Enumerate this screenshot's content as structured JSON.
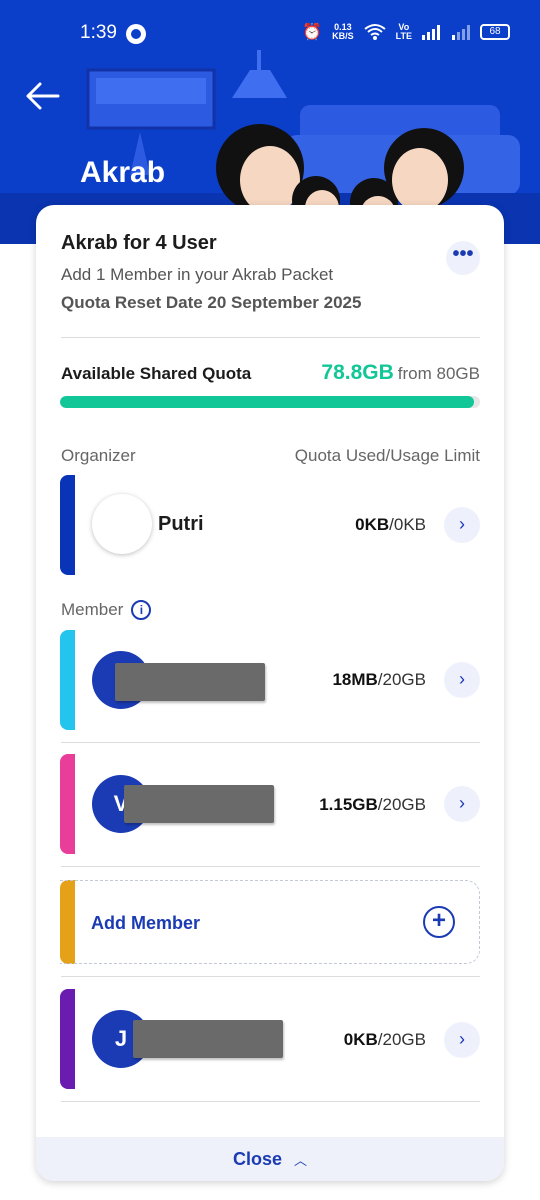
{
  "status_bar": {
    "time": "1:39",
    "net_speed_value": "0.13",
    "net_speed_unit": "KB/S",
    "battery": "68"
  },
  "header": {
    "title": "Akrab",
    "background_color": "#0b3ec9"
  },
  "plan": {
    "title": "Akrab for 4 User",
    "subtitle": "Add 1 Member in your Akrab Packet",
    "reset_date": "Quota Reset Date 20 September 2025"
  },
  "quota": {
    "label": "Available Shared Quota",
    "available": "78.8GB",
    "from": "from 80GB",
    "fill_fraction": 0.985,
    "color": "#12c797"
  },
  "columns": {
    "left": "Organizer",
    "right": "Quota Used/Usage Limit"
  },
  "organizer": {
    "name": "Putri",
    "used": "0KB",
    "limit": "/0KB",
    "stripe_color": "#0a34b8"
  },
  "member_heading": "Member",
  "members": [
    {
      "initial": "",
      "used": "18MB",
      "limit": "/20GB",
      "stripe_color": "#23c4ee"
    },
    {
      "initial": "V",
      "used": "1.15GB",
      "limit": "/20GB",
      "stripe_color": "#e83e9a"
    },
    {
      "initial": "J",
      "used": "0KB",
      "limit": "/20GB",
      "stripe_color": "#6a1bb0"
    }
  ],
  "add_member": {
    "label": "Add Member",
    "stripe_color": "#e5a218"
  },
  "close_label": "Close",
  "accent_color": "#1a3bb3"
}
